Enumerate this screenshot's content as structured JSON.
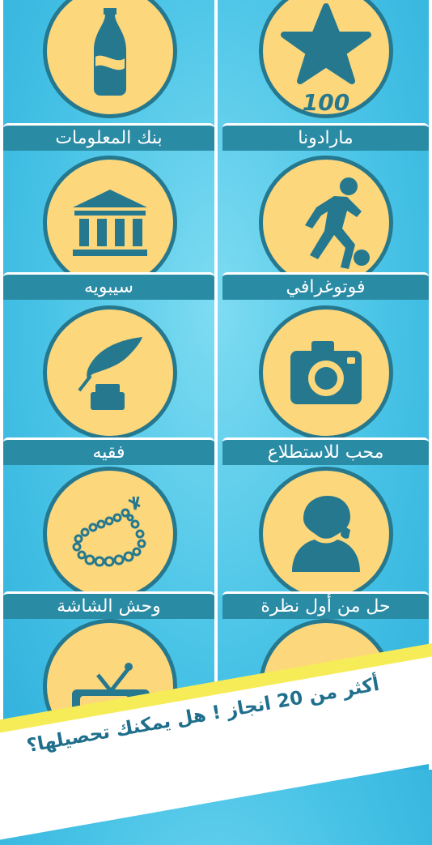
{
  "achievements": [
    {
      "label": "",
      "icon": "star-100-icon",
      "star_number": "100"
    },
    {
      "label": "",
      "icon": "bottle-icon"
    },
    {
      "label": "مارادونا",
      "icon": "soccer-player-icon"
    },
    {
      "label": "بنك المعلومات",
      "icon": "bank-icon"
    },
    {
      "label": "فوتوغرافي",
      "icon": "camera-icon"
    },
    {
      "label": "سيبويه",
      "icon": "quill-inkpot-icon"
    },
    {
      "label": "محب للاستطلاع",
      "icon": "detective-icon"
    },
    {
      "label": "فقيه",
      "icon": "prayer-beads-icon"
    },
    {
      "label": "حل من أول نظرة",
      "icon": "magnifier-icon"
    },
    {
      "label": "وحش الشاشة",
      "icon": "tv-icon"
    }
  ],
  "banner": {
    "line1": "أكثر من 20 انجاز ! هل يمكنك تحصيلها؟"
  },
  "colors": {
    "background": "#48c3e6",
    "circle_fill": "#fcd77c",
    "icon": "#25788e",
    "label_bar": "#2a8ba5",
    "banner_accent": "#f6ec58"
  }
}
